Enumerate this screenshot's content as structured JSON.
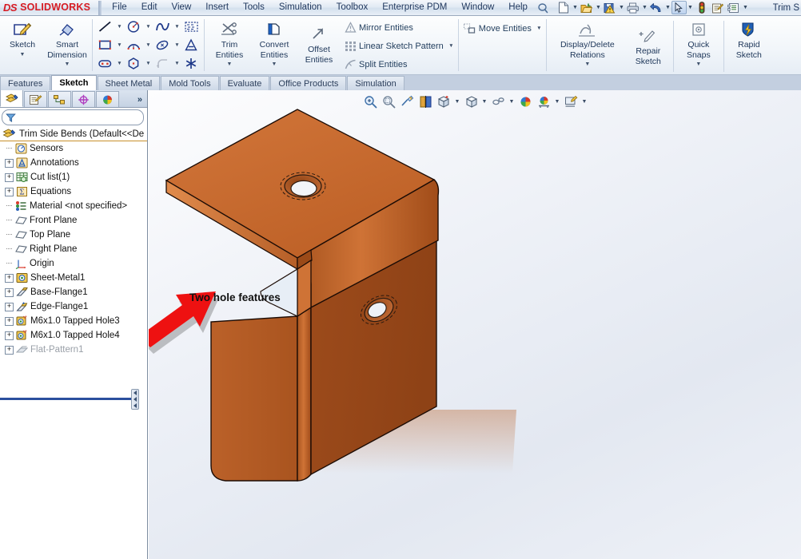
{
  "app": {
    "brand_mark": "DS",
    "brand_name": "SOLIDWORKS",
    "document_title": "Trim S"
  },
  "menu": {
    "items": [
      {
        "label": "File"
      },
      {
        "label": "Edit"
      },
      {
        "label": "View"
      },
      {
        "label": "Insert"
      },
      {
        "label": "Tools"
      },
      {
        "label": "Simulation"
      },
      {
        "label": "Toolbox"
      },
      {
        "label": "Enterprise PDM"
      },
      {
        "label": "Window"
      },
      {
        "label": "Help"
      }
    ],
    "quick_icons": [
      {
        "name": "new-document-icon",
        "glyph": "὜B"
      },
      {
        "name": "open-document-icon",
        "glyph": ""
      },
      {
        "name": "save-icon",
        "glyph": ""
      },
      {
        "name": "print-icon",
        "glyph": ""
      },
      {
        "name": "undo-icon",
        "glyph": ""
      },
      {
        "name": "select-icon",
        "glyph": ""
      },
      {
        "name": "rebuild-icon",
        "glyph": ""
      },
      {
        "name": "file-properties-icon",
        "glyph": ""
      },
      {
        "name": "options-icon",
        "glyph": ""
      }
    ]
  },
  "ribbon": {
    "buttons": [
      {
        "name": "sketch-button",
        "label_line1": "Sketch",
        "label_line2": ""
      },
      {
        "name": "smart-dimension-button",
        "label_line1": "Smart",
        "label_line2": "Dimension"
      },
      {
        "name": "trim-entities-button",
        "label_line1": "Trim",
        "label_line2": "Entities"
      },
      {
        "name": "convert-entities-button",
        "label_line1": "Convert",
        "label_line2": "Entities"
      },
      {
        "name": "offset-entities-button",
        "label_line1": "Offset",
        "label_line2": "Entities"
      },
      {
        "name": "display-delete-relations-button",
        "label_line1": "Display/Delete",
        "label_line2": "Relations"
      },
      {
        "name": "repair-sketch-button",
        "label_line1": "Repair",
        "label_line2": "Sketch"
      },
      {
        "name": "quick-snaps-button",
        "label_line1": "Quick",
        "label_line2": "Snaps"
      },
      {
        "name": "rapid-sketch-button",
        "label_line1": "Rapid",
        "label_line2": "Sketch"
      }
    ],
    "text_commands": [
      {
        "name": "mirror-entities-command",
        "label": "Mirror Entities",
        "icon": "mirror-icon"
      },
      {
        "name": "linear-sketch-pattern-command",
        "label": "Linear Sketch Pattern",
        "icon": "linear-pattern-icon"
      },
      {
        "name": "split-entities-command",
        "label": "Split Entities",
        "icon": "split-icon"
      },
      {
        "name": "move-entities-command",
        "label": "Move Entities",
        "icon": "move-icon"
      }
    ],
    "sketch_tools": [
      {
        "name": "line-tool",
        "icon": "line-icon"
      },
      {
        "name": "circle-tool",
        "icon": "circle-icon"
      },
      {
        "name": "spline-tool",
        "icon": "spline-icon"
      },
      {
        "name": "sketch-fillet-region-tool",
        "icon": "dashed-region-icon"
      },
      {
        "name": "rectangle-tool",
        "icon": "rectangle-icon"
      },
      {
        "name": "arc-tool",
        "icon": "arc-icon"
      },
      {
        "name": "ellipse-tool",
        "icon": "ellipse-icon"
      },
      {
        "name": "text-tool",
        "icon": "text-a-icon"
      },
      {
        "name": "slot-tool",
        "icon": "slot-icon"
      },
      {
        "name": "polygon-tool",
        "icon": "polygon-icon"
      },
      {
        "name": "sketch-fillet-tool",
        "icon": "fillet-icon"
      },
      {
        "name": "point-tool",
        "icon": "point-star-icon"
      }
    ]
  },
  "command_tabs": [
    {
      "label": "Features",
      "active": false
    },
    {
      "label": "Sketch",
      "active": true
    },
    {
      "label": "Sheet Metal",
      "active": false
    },
    {
      "label": "Mold Tools",
      "active": false
    },
    {
      "label": "Evaluate",
      "active": false
    },
    {
      "label": "Office Products",
      "active": false
    },
    {
      "label": "Simulation",
      "active": false
    }
  ],
  "feature_manager": {
    "tabs": [
      {
        "name": "feature-tree-tab",
        "icon": "feature-tree-icon",
        "active": true
      },
      {
        "name": "property-manager-tab",
        "icon": "property-manager-icon",
        "active": false
      },
      {
        "name": "configuration-manager-tab",
        "icon": "configuration-manager-icon",
        "active": false
      },
      {
        "name": "dimxpert-manager-tab",
        "icon": "dimxpert-icon",
        "active": false
      },
      {
        "name": "display-manager-tab",
        "icon": "display-manager-icon",
        "active": false
      }
    ],
    "more_tabs_label": "»",
    "filter": {
      "placeholder": "",
      "value": "",
      "icon": "filter-icon"
    },
    "root": {
      "label": "Trim Side Bends  (Default<<De",
      "icon": "part-icon"
    },
    "tree_items": [
      {
        "label": "Sensors",
        "icon": "sensors-icon",
        "expandable": false,
        "dimmed": false
      },
      {
        "label": "Annotations",
        "icon": "annotations-icon",
        "expandable": true,
        "dimmed": false
      },
      {
        "label": "Cut list(1)",
        "icon": "cutlist-icon",
        "expandable": true,
        "dimmed": false
      },
      {
        "label": "Equations",
        "icon": "equations-icon",
        "expandable": true,
        "dimmed": false
      },
      {
        "label": "Material <not specified>",
        "icon": "material-icon",
        "expandable": false,
        "dimmed": false
      },
      {
        "label": "Front Plane",
        "icon": "plane-icon",
        "expandable": false,
        "dimmed": false
      },
      {
        "label": "Top Plane",
        "icon": "plane-icon",
        "expandable": false,
        "dimmed": false
      },
      {
        "label": "Right Plane",
        "icon": "plane-icon",
        "expandable": false,
        "dimmed": false
      },
      {
        "label": "Origin",
        "icon": "origin-icon",
        "expandable": false,
        "dimmed": false
      },
      {
        "label": "Sheet-Metal1",
        "icon": "sheet-metal-icon",
        "expandable": true,
        "dimmed": false
      },
      {
        "label": "Base-Flange1",
        "icon": "base-flange-icon",
        "expandable": true,
        "dimmed": false
      },
      {
        "label": "Edge-Flange1",
        "icon": "edge-flange-icon",
        "expandable": true,
        "dimmed": false
      },
      {
        "label": "M6x1.0 Tapped Hole3",
        "icon": "tapped-hole-icon",
        "expandable": true,
        "dimmed": false
      },
      {
        "label": "M6x1.0 Tapped Hole4",
        "icon": "tapped-hole-icon",
        "expandable": true,
        "dimmed": false
      },
      {
        "label": "Flat-Pattern1",
        "icon": "flat-pattern-icon",
        "expandable": true,
        "dimmed": true
      }
    ]
  },
  "viewport": {
    "heads_up_tools": [
      {
        "name": "zoom-to-fit-icon"
      },
      {
        "name": "zoom-to-area-icon"
      },
      {
        "name": "previous-view-icon"
      },
      {
        "name": "section-view-icon"
      },
      {
        "name": "view-orientation-icon"
      },
      {
        "name": "display-style-icon"
      },
      {
        "name": "hide-show-items-icon"
      },
      {
        "name": "edit-appearance-icon"
      },
      {
        "name": "apply-scene-icon"
      },
      {
        "name": "view-settings-icon"
      }
    ],
    "annotation": {
      "text": "Two hole features",
      "arrow_color": "#ee1111"
    },
    "model": {
      "name": "sheet-metal-bracket",
      "body_color": "#c4672c",
      "top_face_color": "#cf7035",
      "side_face_color": "#a8521f",
      "edge_color": "#221008"
    }
  },
  "colors": {
    "brand_red": "#d61b23",
    "ribbon_text": "#1c3558",
    "tree_text": "#111111",
    "accent_blue": "#2b4f9e",
    "annotation_red": "#ee1111"
  }
}
